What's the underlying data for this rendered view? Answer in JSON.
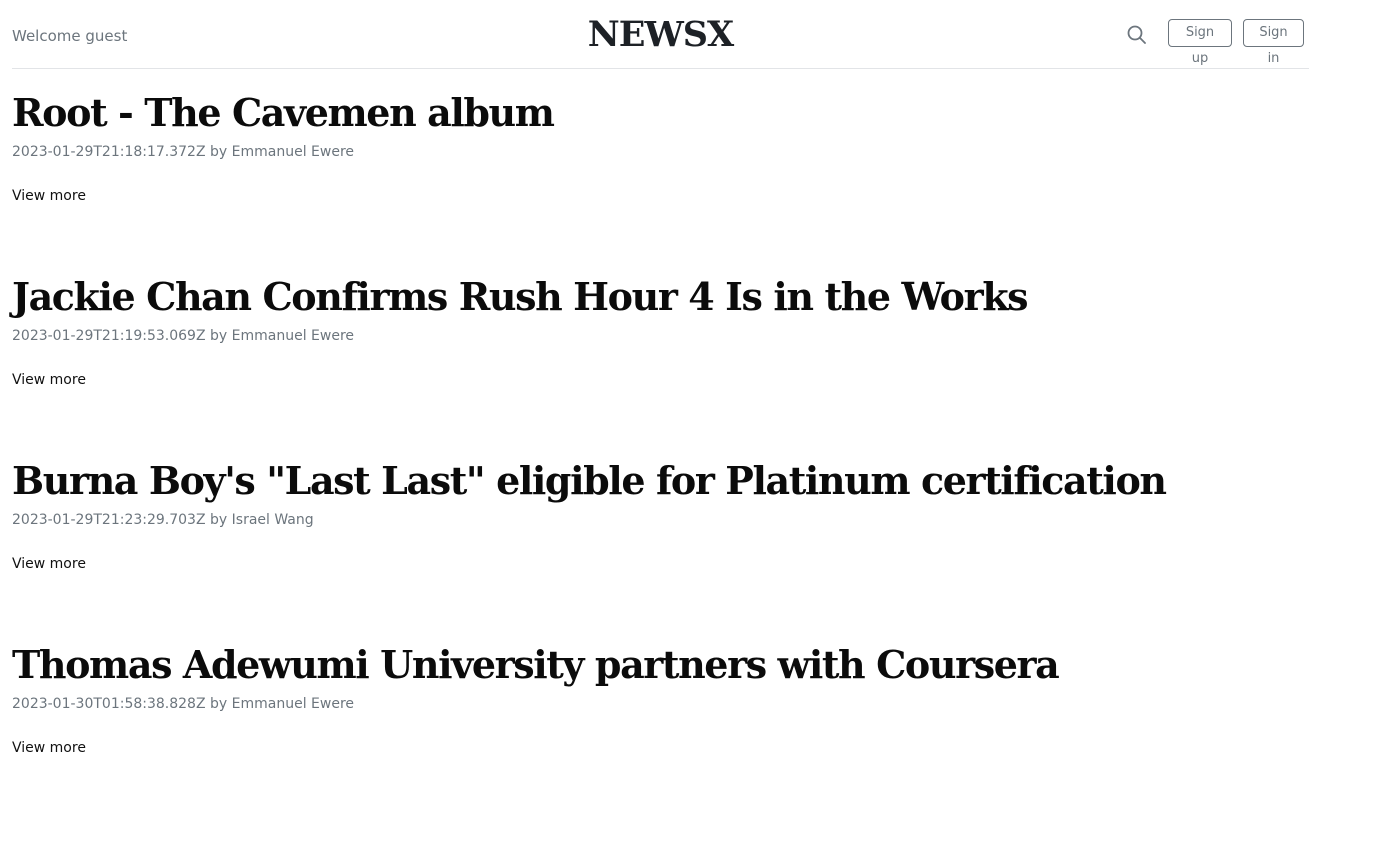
{
  "header": {
    "welcome_text": "Welcome guest",
    "brand": "NEWSX",
    "search_icon": "search-icon",
    "signup_label": "Sign up",
    "signin_label": "Sign in"
  },
  "articles": [
    {
      "title": "Root - The Cavemen album",
      "date": "2023-01-29T21:18:17.372Z",
      "by": "by",
      "author": "Emmanuel Ewere",
      "link_label": "View more"
    },
    {
      "title": "Jackie Chan Confirms Rush Hour 4 Is in the Works",
      "date": "2023-01-29T21:19:53.069Z",
      "by": "by",
      "author": "Emmanuel Ewere",
      "link_label": "View more"
    },
    {
      "title": "Burna Boy's \"Last Last\" eligible for Platinum certification",
      "date": "2023-01-29T21:23:29.703Z",
      "by": "by",
      "author": "Israel Wang",
      "link_label": "View more"
    },
    {
      "title": "Thomas Adewumi University partners with Coursera",
      "date": "2023-01-30T01:58:38.828Z",
      "by": "by",
      "author": "Emmanuel Ewere",
      "link_label": "View more"
    }
  ]
}
